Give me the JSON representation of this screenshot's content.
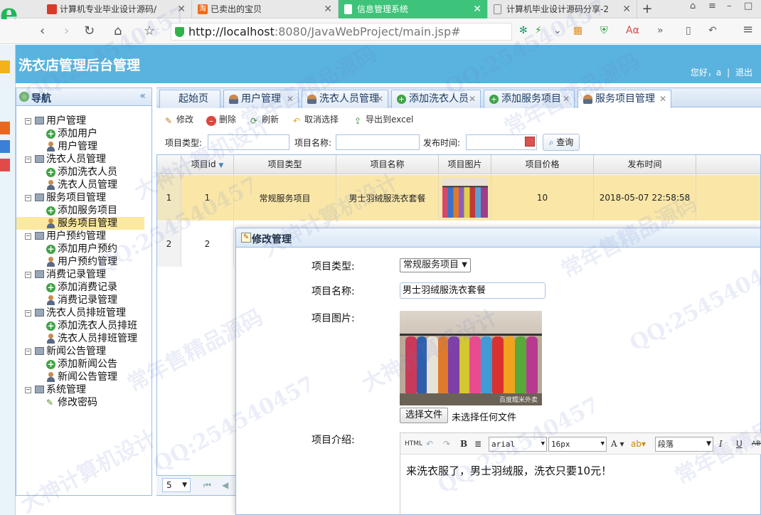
{
  "browser": {
    "tabs": [
      {
        "label": "计算机专业毕业设计源码/",
        "favicon_color": "#d83a2a"
      },
      {
        "label": "已卖出的宝贝",
        "favicon_color": "#ef6a1a"
      },
      {
        "label": "信息管理系统",
        "favicon_color": "#ffffff",
        "active": true
      },
      {
        "label": "计算机毕业设计源码分享-2",
        "favicon_color": "#888888"
      }
    ],
    "url_host": "http://localhost",
    "url_rest": ":8080/JavaWebProject/main.jsp#"
  },
  "app": {
    "title": "洗衣店管理后台管理",
    "greeting": "您好，a",
    "logout": "退出",
    "accent": "#5ab3de"
  },
  "sidebar": {
    "title": "导航",
    "groups": [
      {
        "label": "用户管理",
        "items": [
          "添加用户",
          "用户管理"
        ]
      },
      {
        "label": "洗衣人员管理",
        "items": [
          "添加洗衣人员",
          "洗衣人员管理"
        ]
      },
      {
        "label": "服务项目管理",
        "items": [
          "添加服务项目",
          "服务项目管理"
        ]
      },
      {
        "label": "用户预约管理",
        "items": [
          "添加用户预约",
          "用户预约管理"
        ]
      },
      {
        "label": "消费记录管理",
        "items": [
          "添加消费记录",
          "消费记录管理"
        ]
      },
      {
        "label": "洗衣人员排班管理",
        "items": [
          "添加洗衣人员排班",
          "洗衣人员排班管理"
        ]
      },
      {
        "label": "新闻公告管理",
        "items": [
          "添加新闻公告",
          "新闻公告管理"
        ]
      },
      {
        "label": "系统管理",
        "items": [
          "修改密码"
        ]
      }
    ],
    "selected": "服务项目管理"
  },
  "tabs": [
    "起始页",
    "用户管理",
    "洗衣人员管理",
    "添加洗衣人员",
    "添加服务项目",
    "服务项目管理"
  ],
  "toolbar": {
    "edit": "修改",
    "delete": "删除",
    "refresh": "刷新",
    "cancel_select": "取消选择",
    "export": "导出到excel"
  },
  "search": {
    "type_label": "项目类型:",
    "name_label": "项目名称:",
    "time_label": "发布时间:",
    "query": "查询"
  },
  "grid": {
    "columns": [
      "项目id",
      "项目类型",
      "项目名称",
      "项目图片",
      "项目价格",
      "发布时间"
    ],
    "rows": [
      {
        "num": "1",
        "id": "1",
        "type": "常规服务项目",
        "name": "男士羽绒服洗衣套餐",
        "price": "10",
        "time": "2018-05-07 22:58:58"
      },
      {
        "num": "2",
        "id": "2",
        "type": "",
        "name": "",
        "price": "",
        "time": ""
      }
    ],
    "page_size": "5"
  },
  "dialog": {
    "title": "修改管理",
    "type_label": "项目类型:",
    "type_value": "常规服务项目",
    "name_label": "项目名称:",
    "name_value": "男士羽绒服洗衣套餐",
    "image_label": "项目图片:",
    "image_watermark": "百度糯米外卖",
    "file_button": "选择文件",
    "file_status": "未选择任何文件",
    "intro_label": "项目介绍:",
    "editor": {
      "html": "HTML",
      "bold": "B",
      "font": "arial",
      "size": "16px",
      "paragraph": "段落",
      "italic": "I",
      "underline": "U",
      "strike": "ABC",
      "content": "来洗衣服了，男士羽绒服，洗衣只要10元！"
    }
  },
  "watermarks": {
    "qq": "QQ:254540457",
    "t1": "大神计算机设计",
    "t2": "常年售精品源码"
  }
}
